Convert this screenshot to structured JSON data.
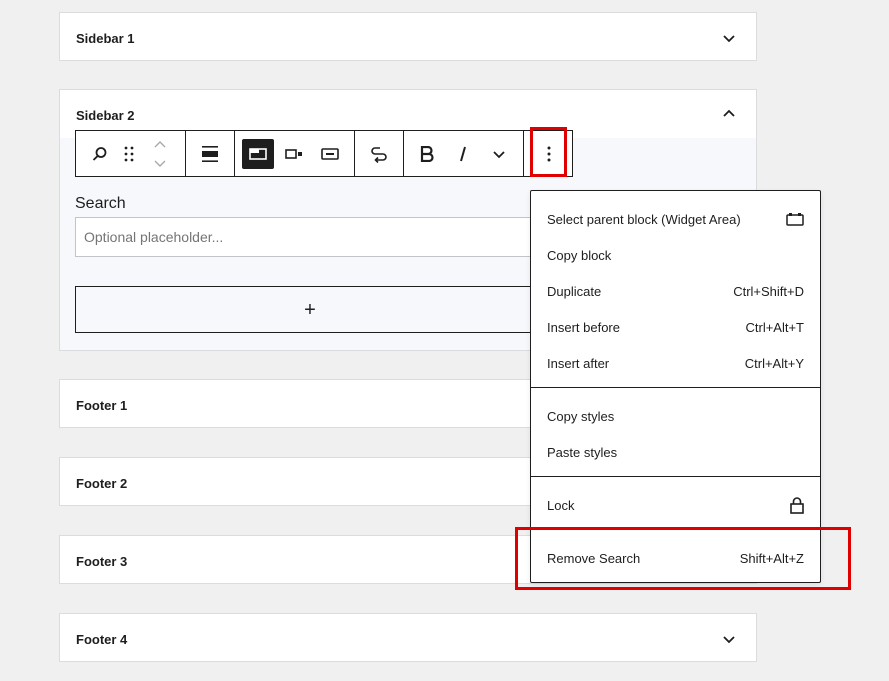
{
  "panels": {
    "sidebar1": "Sidebar 1",
    "sidebar2": "Sidebar 2",
    "footer1": "Footer 1",
    "footer2": "Footer 2",
    "footer3": "Footer 3",
    "footer4": "Footer 4"
  },
  "block": {
    "label": "Search",
    "placeholder": "Optional placeholder...",
    "appender_symbol": "+"
  },
  "toolbar": {
    "icons": [
      "search-icon",
      "drag-handle-icon",
      "move-up-down-icon",
      "align-icon",
      "button-inside-icon",
      "button-outside-icon",
      "no-button-icon",
      "link-icon",
      "bold-icon",
      "italic-icon",
      "more-formats-icon",
      "options-icon"
    ],
    "active": "button-inside-icon"
  },
  "menu": {
    "items": [
      {
        "label": "Select parent block (Widget Area)",
        "shortcut": ""
      },
      {
        "label": "Copy block",
        "shortcut": ""
      },
      {
        "label": "Duplicate",
        "shortcut": "Ctrl+Shift+D"
      },
      {
        "label": "Insert before",
        "shortcut": "Ctrl+Alt+T"
      },
      {
        "label": "Insert after",
        "shortcut": "Ctrl+Alt+Y"
      },
      {
        "label": "Copy styles",
        "shortcut": ""
      },
      {
        "label": "Paste styles",
        "shortcut": ""
      },
      {
        "label": "Lock",
        "shortcut": ""
      },
      {
        "label": "Remove Search",
        "shortcut": "Shift+Alt+Z"
      }
    ]
  },
  "colors": {
    "highlight": "#e00000",
    "background": "#f0f0f1",
    "text": "#1e1e1e"
  }
}
